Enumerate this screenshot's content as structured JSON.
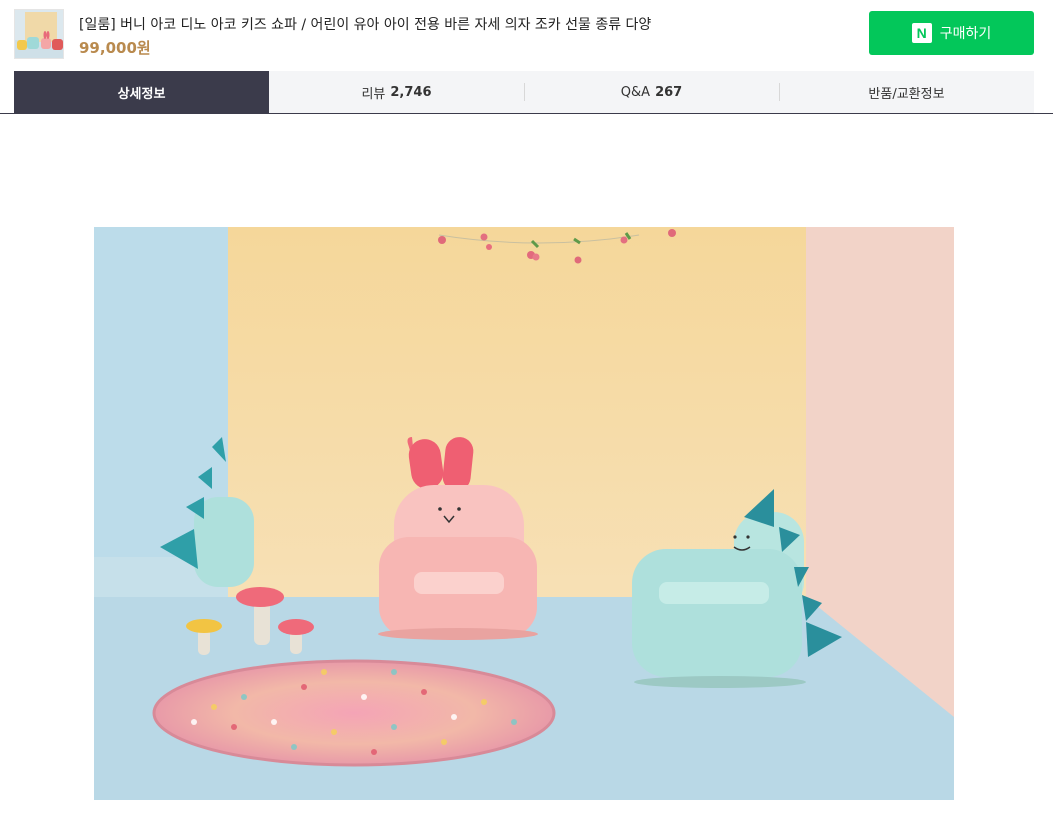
{
  "product": {
    "title": "[일룸] 버니 아코 디노 아코 키즈 쇼파 / 어린이 유아 아이 전용 바른 자세 의자 조카 선물 종류 다양",
    "price": "99,000원",
    "buy_label": "구매하기",
    "buy_logo": "N"
  },
  "tabs": [
    {
      "label": "상세정보",
      "count": ""
    },
    {
      "label": "리뷰",
      "count": "2,746"
    },
    {
      "label": "Q&A",
      "count": "267"
    },
    {
      "label": "반품/교환정보",
      "count": ""
    }
  ],
  "colors": {
    "brand_green": "#03c75a",
    "active_tab": "#3b3b4b",
    "price": "#b98a4e"
  }
}
